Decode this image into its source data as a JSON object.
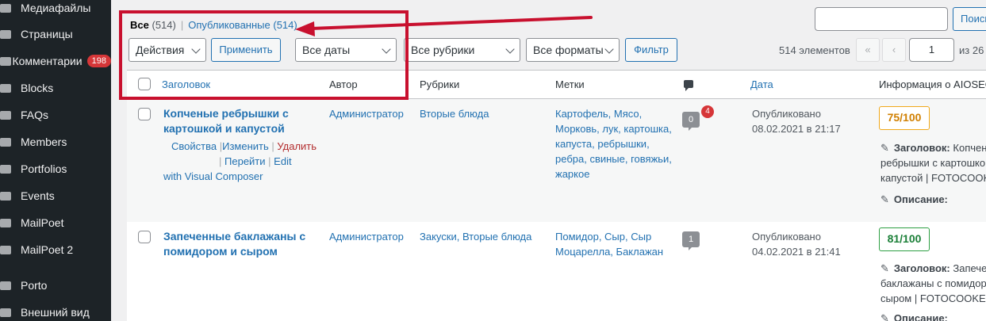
{
  "sidebar": {
    "items": [
      {
        "label": "Медиафайлы",
        "icon": "media-icon"
      },
      {
        "label": "Страницы",
        "icon": "pages-icon"
      },
      {
        "label": "Комментарии",
        "icon": "comments-icon",
        "badge": "198"
      },
      {
        "label": "Blocks",
        "icon": "blocks-icon"
      },
      {
        "label": "FAQs",
        "icon": "faq-icon"
      },
      {
        "label": "Members",
        "icon": "members-icon"
      },
      {
        "label": "Portfolios",
        "icon": "portfolio-icon"
      },
      {
        "label": "Events",
        "icon": "events-icon"
      },
      {
        "label": "MailPoet",
        "icon": "mailpoet-icon"
      },
      {
        "label": "MailPoet 2",
        "icon": "mailpoet-icon"
      },
      {
        "label": "Porto",
        "icon": "porto-icon"
      },
      {
        "label": "Внешний вид",
        "icon": "appearance-icon"
      }
    ]
  },
  "views": {
    "all_label": "Все",
    "all_count": "(514)",
    "separator": "|",
    "published_label": "Опубликованные",
    "published_count": "(514)"
  },
  "search": {
    "button": "Поиск"
  },
  "filters": {
    "bulk_action": "Действия",
    "apply": "Применить",
    "dates": "Все даты",
    "categories": "Все рубрики",
    "formats": "Все форматы",
    "filter_button": "Фильтр"
  },
  "pagination": {
    "count": "514 элементов",
    "first": "«",
    "prev": "‹",
    "current_page": "1",
    "total": "из 26"
  },
  "table": {
    "headers": {
      "title": "Заголовок",
      "author": "Автор",
      "categories": "Рубрики",
      "tags": "Метки",
      "date": "Дата",
      "aioseo": "Информация о AIOSEO"
    },
    "rows": [
      {
        "title_line1": "Копченые ребрышки с",
        "title_line2": "картошкой и капустой",
        "actions": {
          "properties": "Свойства",
          "edit": "Изменить",
          "delete": "Удалить",
          "view": "Перейти",
          "edit_en": "Edit",
          "vc": "with Visual Composer"
        },
        "author": "Администратор",
        "categories": "Вторые блюда",
        "tags": [
          "Картофель, Мясо,",
          "Морковь, лук, картошка,",
          "капуста, ребрышки,",
          "ребра, свиные, говяжьи,",
          "жаркое"
        ],
        "comments": "0",
        "pending": "4",
        "date_status": "Опубликовано",
        "date": "08.02.2021 в 21:17",
        "score": "75/100",
        "seo_title_label": "Заголовок:",
        "seo_title_lines": [
          "Копчен",
          "ребрышки с картошко",
          "капустой | FOTOCOOKER"
        ],
        "seo_desc_label": "Описание:"
      },
      {
        "title_line1": "Запеченные баклажаны с",
        "title_line2": "помидором и сыром",
        "author": "Администратор",
        "categories": "Закуски, Вторые блюда",
        "tags": [
          "Помидор, Сыр, Сыр",
          "Моцарелла, Баклажан"
        ],
        "comments": "1",
        "date_status": "Опубликовано",
        "date": "04.02.2021 в 21:41",
        "score": "81/100",
        "seo_title_label": "Заголовок:",
        "seo_title_lines": [
          "Запече",
          "баклажаны с помидор",
          "сыром | FOTOCOOKERY"
        ],
        "seo_desc_label": "Описание:"
      }
    ]
  },
  "colors": {
    "annotation": "#c8102e",
    "accent": "#2271b1",
    "score_orange": "#f0a81a",
    "score_green": "#2ea043"
  }
}
